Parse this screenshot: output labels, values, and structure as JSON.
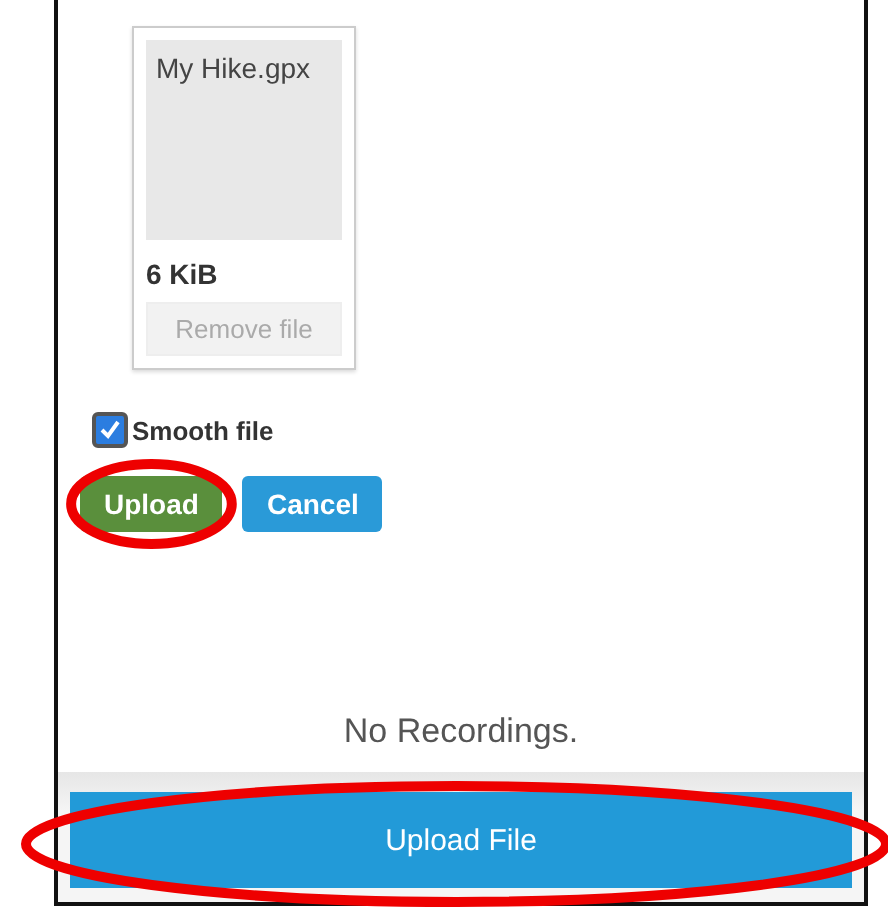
{
  "file_card": {
    "name": "My Hike.gpx",
    "size": "6 KiB",
    "remove_label": "Remove file"
  },
  "smooth": {
    "label": "Smooth file",
    "checked": true
  },
  "actions": [
    {
      "label": "Upload",
      "kind": "primary",
      "circled": true
    },
    {
      "label": "Cancel",
      "kind": "secondary",
      "circled": false
    }
  ],
  "empty_message": "No Recordings.",
  "footer_button": {
    "label": "Upload File",
    "circled": true
  }
}
